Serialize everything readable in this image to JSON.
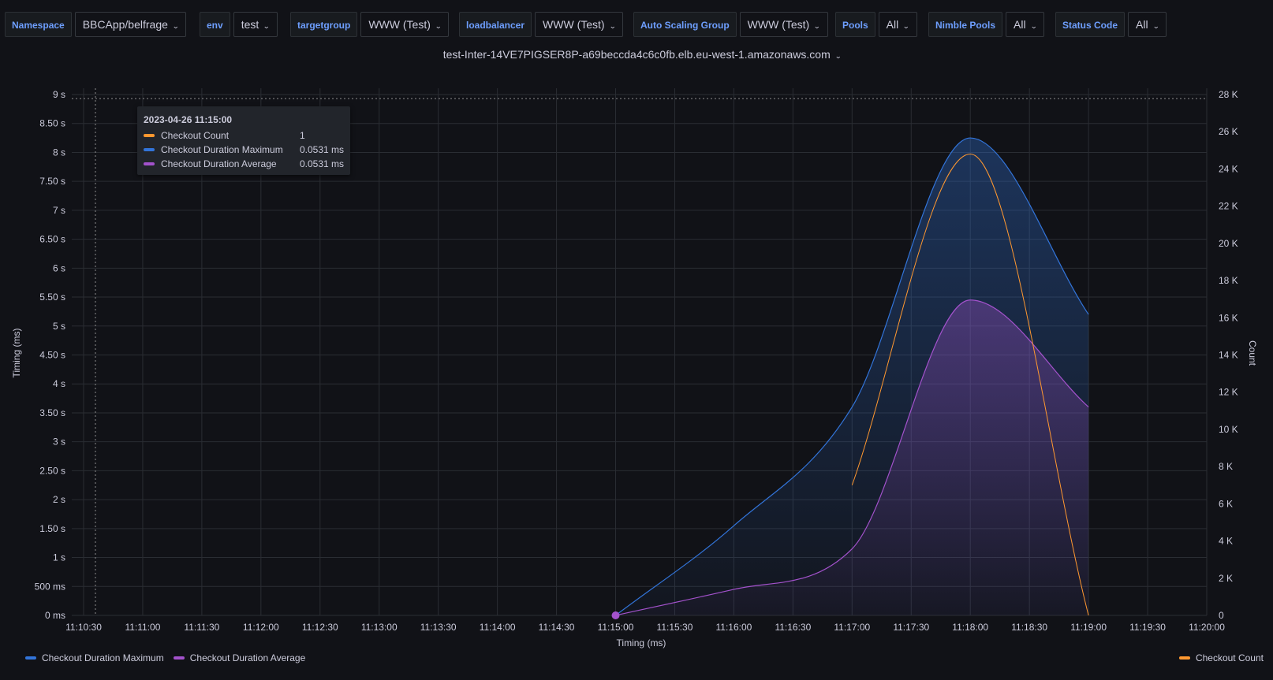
{
  "variables": [
    {
      "label": "Namespace",
      "value": "BBCApp/belfrage"
    },
    {
      "label": "env",
      "value": "test"
    },
    {
      "label": "targetgroup",
      "value": "WWW (Test)"
    },
    {
      "label": "loadbalancer",
      "value": "WWW (Test)"
    },
    {
      "label": "Auto Scaling Group",
      "value": "WWW (Test)"
    },
    {
      "label": "Pools",
      "value": "All"
    },
    {
      "label": "Nimble Pools",
      "value": "All"
    },
    {
      "label": "Status Code",
      "value": "All"
    }
  ],
  "loadbalancer_select": "test-Inter-14VE7PIGSER8P-a69beccda4c6c0fb.elb.eu-west-1.amazonaws.com",
  "tooltip": {
    "time": "2023-04-26 11:15:00",
    "rows": [
      {
        "name": "Checkout Count",
        "value": "1",
        "color": "#ff9830"
      },
      {
        "name": "Checkout Duration Maximum",
        "value": "0.0531 ms",
        "color": "#3274d9"
      },
      {
        "name": "Checkout Duration Average",
        "value": "0.0531 ms",
        "color": "#a352cc"
      }
    ]
  },
  "legend": {
    "left": [
      {
        "name": "Checkout Duration Maximum",
        "color": "#3274d9"
      },
      {
        "name": "Checkout Duration Average",
        "color": "#a352cc"
      }
    ],
    "right": [
      {
        "name": "Checkout Count",
        "color": "#ff9830"
      }
    ]
  },
  "chart_data": {
    "type": "area",
    "xlabel": "Timing (ms)",
    "ylabel": "Timing (ms)",
    "y2label": "Count",
    "xlim": [
      "11:10:24",
      "11:20:00"
    ],
    "x_ticks": [
      "11:10:30",
      "11:11:00",
      "11:11:30",
      "11:12:00",
      "11:12:30",
      "11:13:00",
      "11:13:30",
      "11:14:00",
      "11:14:30",
      "11:15:00",
      "11:15:30",
      "11:16:00",
      "11:16:30",
      "11:17:00",
      "11:17:30",
      "11:18:00",
      "11:18:30",
      "11:19:00",
      "11:19:30",
      "11:20:00"
    ],
    "ylim": [
      0,
      9
    ],
    "y_ticks": [
      "0 ms",
      "500 ms",
      "1 s",
      "1.50 s",
      "2 s",
      "2.50 s",
      "3 s",
      "3.50 s",
      "4 s",
      "4.50 s",
      "5 s",
      "5.50 s",
      "6 s",
      "6.50 s",
      "7 s",
      "7.50 s",
      "8 s",
      "8.50 s",
      "9 s"
    ],
    "y2lim": [
      0,
      28000
    ],
    "y2_ticks": [
      "0",
      "2 K",
      "4 K",
      "6 K",
      "8 K",
      "10 K",
      "12 K",
      "14 K",
      "16 K",
      "18 K",
      "20 K",
      "22 K",
      "24 K",
      "26 K",
      "28 K"
    ],
    "threshold_y": 8.93,
    "cursor_x": "11:10:36",
    "series": [
      {
        "name": "Checkout Duration Maximum",
        "axis": "left",
        "color": "#3274d9",
        "x": [
          "11:15:00",
          "11:16:00",
          "11:17:00",
          "11:18:00",
          "11:19:00"
        ],
        "values": [
          0.0001,
          1.55,
          3.6,
          8.25,
          5.2
        ]
      },
      {
        "name": "Checkout Duration Average",
        "axis": "left",
        "color": "#a352cc",
        "x": [
          "11:15:00",
          "11:16:00",
          "11:17:00",
          "11:18:00",
          "11:19:00"
        ],
        "values": [
          0.0001,
          0.45,
          1.15,
          5.45,
          3.6
        ]
      },
      {
        "name": "Checkout Count",
        "axis": "right",
        "color": "#ff9830",
        "x": [
          "11:17:00",
          "11:18:00",
          "11:19:00"
        ],
        "values": [
          7000,
          24800,
          0
        ]
      }
    ],
    "highlight_point": {
      "series": "Checkout Duration Average",
      "x": "11:15:00",
      "y": 0.0001
    }
  }
}
